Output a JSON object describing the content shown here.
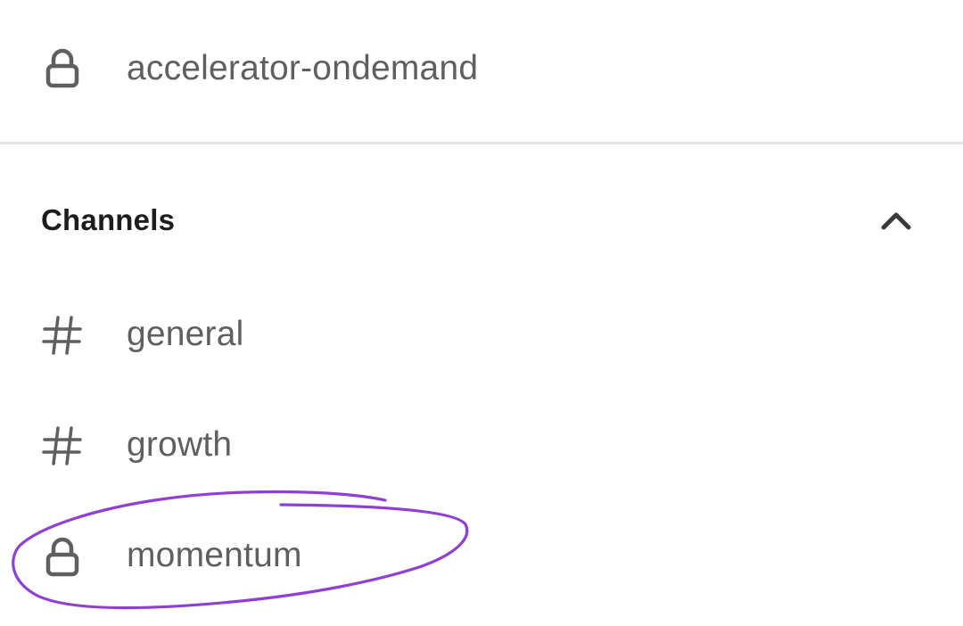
{
  "private_channel": {
    "label": "accelerator-ondemand",
    "icon": "lock-icon"
  },
  "channels_section": {
    "title": "Channels",
    "toggle_icon": "chevron-up-icon",
    "items": [
      {
        "label": "general",
        "icon": "hash-icon"
      },
      {
        "label": "growth",
        "icon": "hash-icon"
      },
      {
        "label": "momentum",
        "icon": "lock-icon"
      }
    ]
  },
  "annotation": {
    "color": "#8e3fd6",
    "shape": "hand-drawn-circle",
    "target": "momentum"
  },
  "colors": {
    "text": "#5f5f5f",
    "heading": "#1d1d1d",
    "divider": "#e3e3e3",
    "background": "#ffffff"
  }
}
